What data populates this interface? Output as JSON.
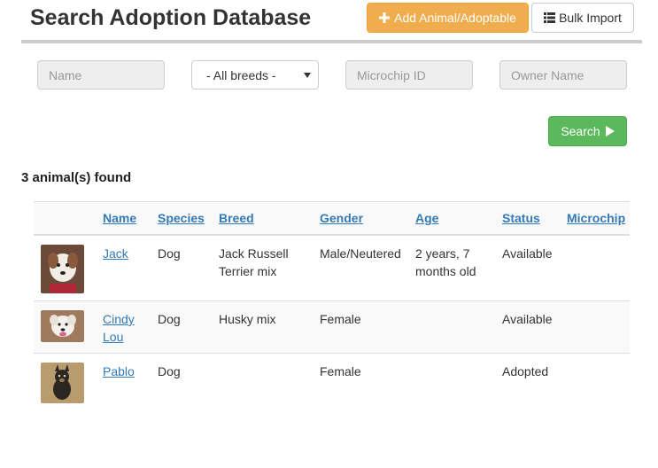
{
  "header": {
    "title": "Search Adoption Database",
    "add_button": "Add Animal/Adoptable",
    "import_button": "Bulk Import"
  },
  "filters": {
    "name_placeholder": "Name",
    "breed_selected": "- All breeds -",
    "microchip_placeholder": "Microchip ID",
    "owner_placeholder": "Owner Name",
    "search_button": "Search"
  },
  "results": {
    "count_text": "3 animal(s) found",
    "columns": [
      "Name",
      "Species",
      "Breed",
      "Gender",
      "Age",
      "Status",
      "Microchip"
    ],
    "rows": [
      {
        "name": "Jack",
        "species": "Dog",
        "breed": "Jack Russell Terrier mix",
        "gender": "Male/Neutered",
        "age": "2 years, 7 months old",
        "status": "Available",
        "microchip": ""
      },
      {
        "name": "Cindy Lou",
        "species": "Dog",
        "breed": "Husky mix",
        "gender": "Female",
        "age": "",
        "status": "Available",
        "microchip": ""
      },
      {
        "name": "Pablo",
        "species": "Dog",
        "breed": "",
        "gender": "Female",
        "age": "",
        "status": "Adopted",
        "microchip": ""
      }
    ]
  },
  "colors": {
    "add_button": "#f0ad4e",
    "search_button": "#5cb85c",
    "link": "#337ab7"
  }
}
